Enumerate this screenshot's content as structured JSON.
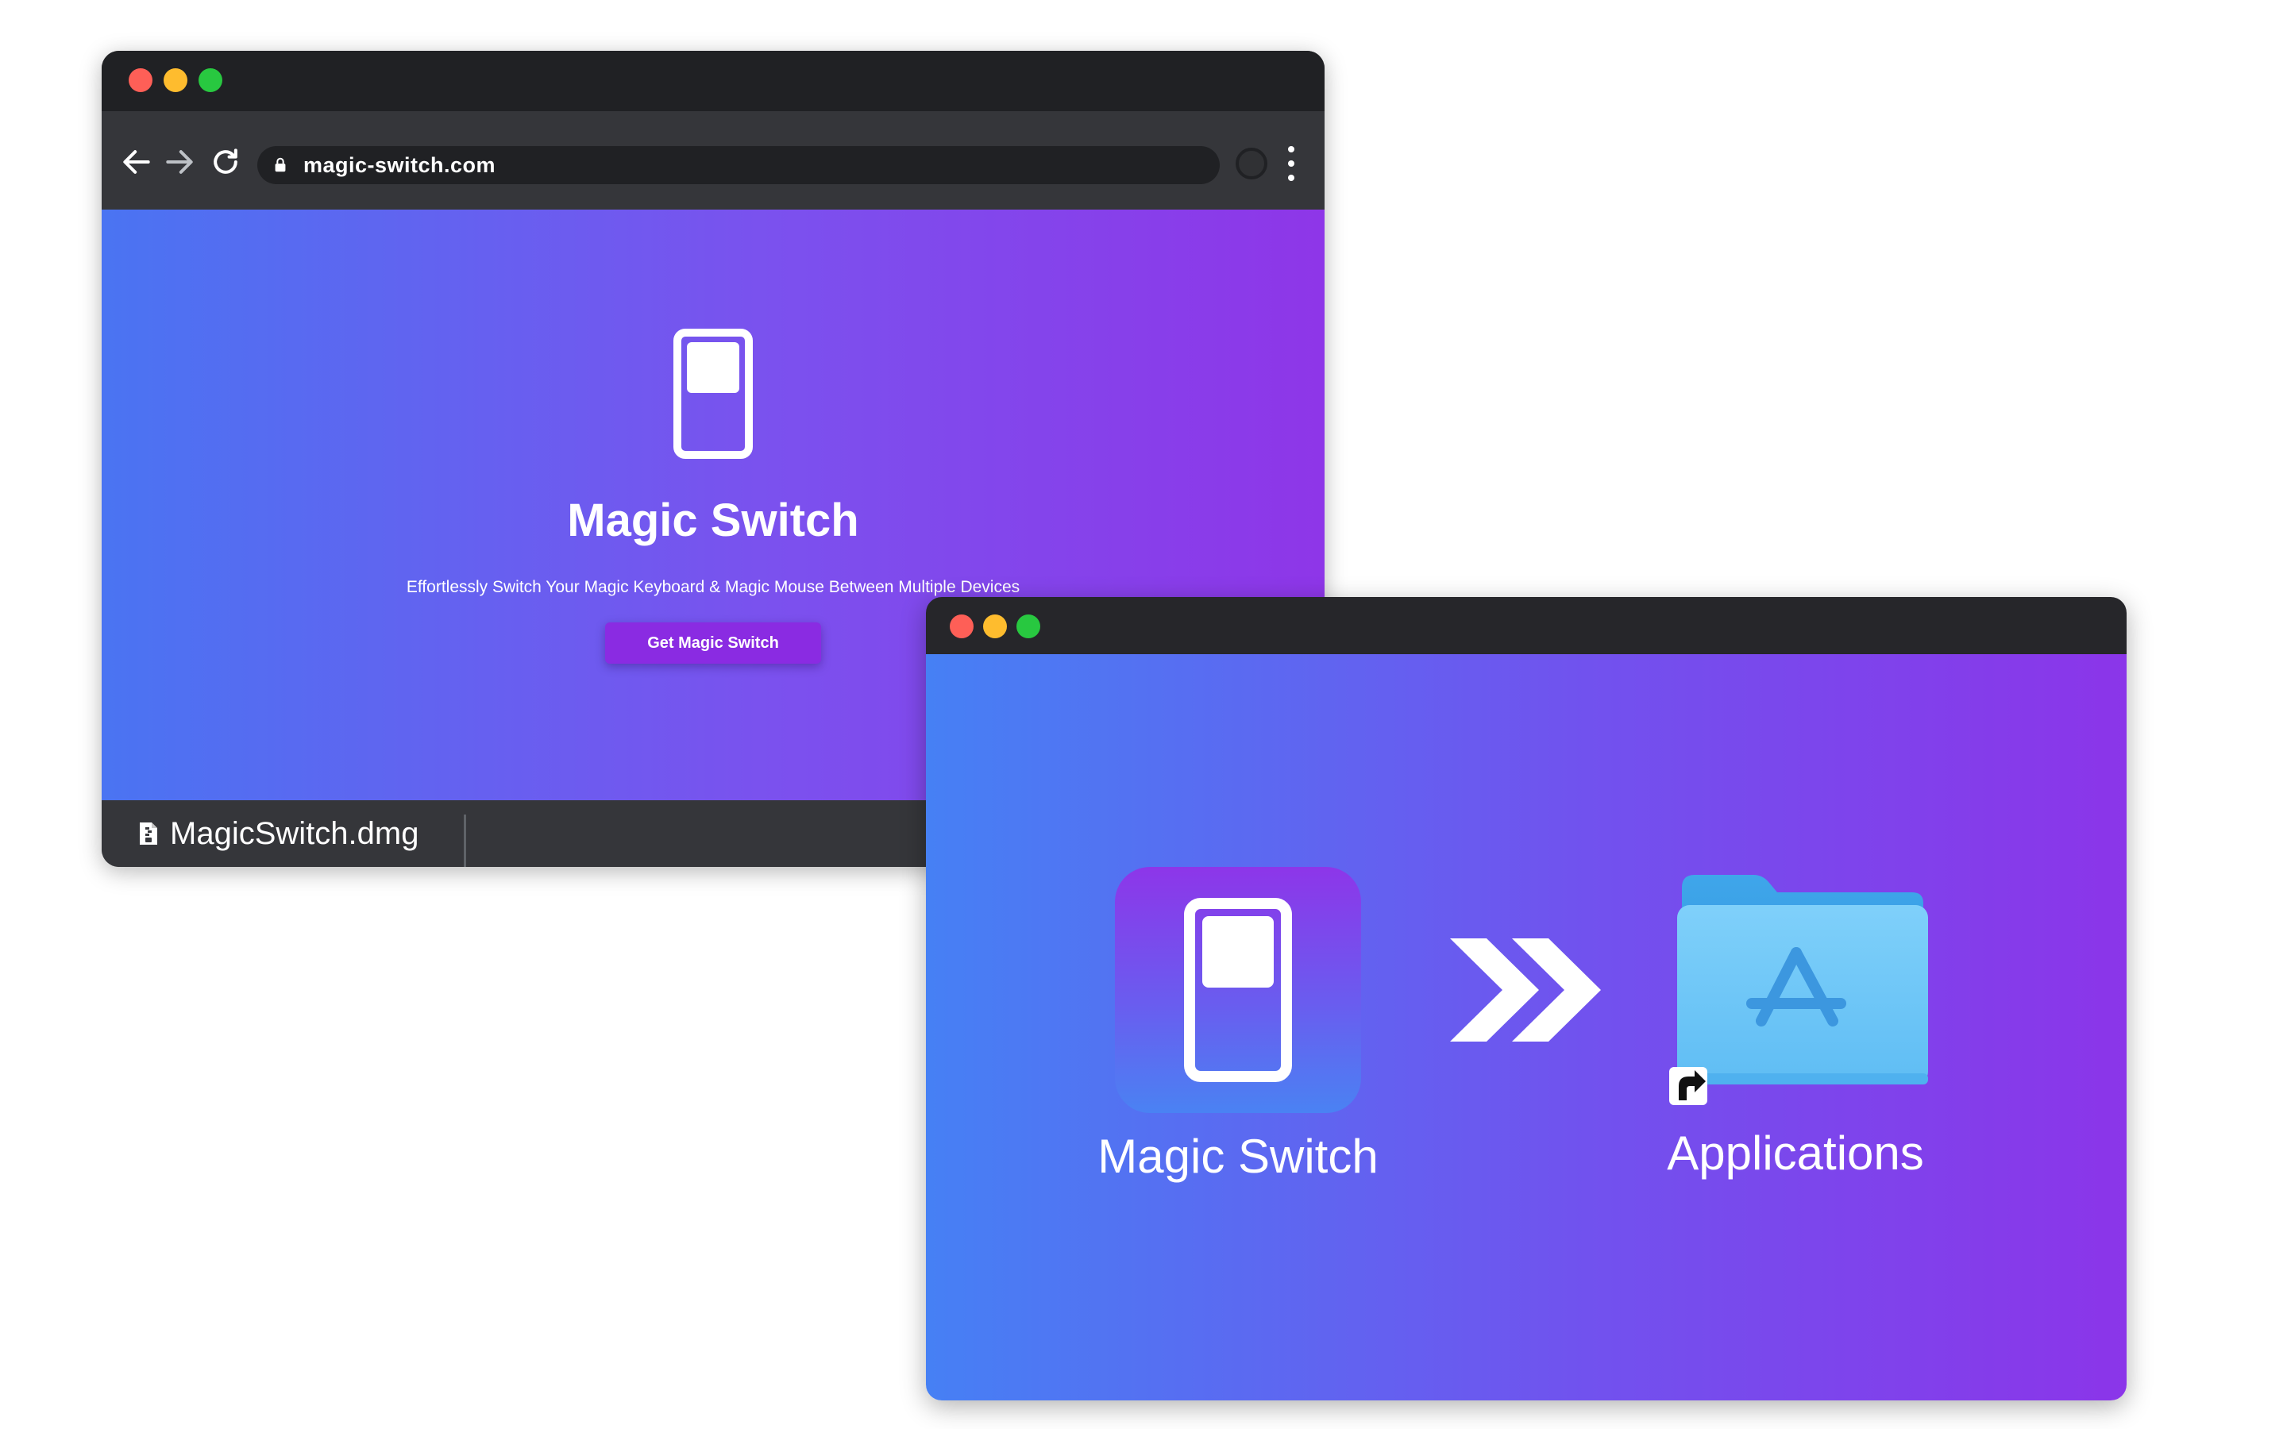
{
  "browser": {
    "url": "magic-switch.com",
    "page": {
      "title": "Magic Switch",
      "tagline": "Effortlessly Switch Your Magic Keyboard & Magic Mouse Between Multiple Devices",
      "cta_label": "Get Magic Switch"
    },
    "download": {
      "filename": "MagicSwitch.dmg"
    }
  },
  "dmg_window": {
    "app_label": "Magic Switch",
    "folder_label": "Applications"
  },
  "icons": {
    "window_controls": [
      "close-dot",
      "minimize-dot",
      "zoom-dot"
    ],
    "browser": [
      "back-arrow-icon",
      "forward-arrow-icon",
      "reload-icon",
      "lock-icon",
      "profile-icon",
      "kebab-menu-icon"
    ],
    "content": [
      "switch-icon",
      "file-icon",
      "double-chevron-right-icon",
      "applications-folder-icon",
      "alias-arrow-icon"
    ]
  },
  "colors": {
    "window_chrome": "#202124",
    "toolbar": "#35363a",
    "gradient_start": "#4a74f2",
    "gradient_end": "#8e36e8",
    "cta_button": "#8a2be2",
    "folder_blue": "#6cc6f6",
    "close": "#fe5f57",
    "minimize": "#febc2e",
    "zoom": "#28c840"
  }
}
